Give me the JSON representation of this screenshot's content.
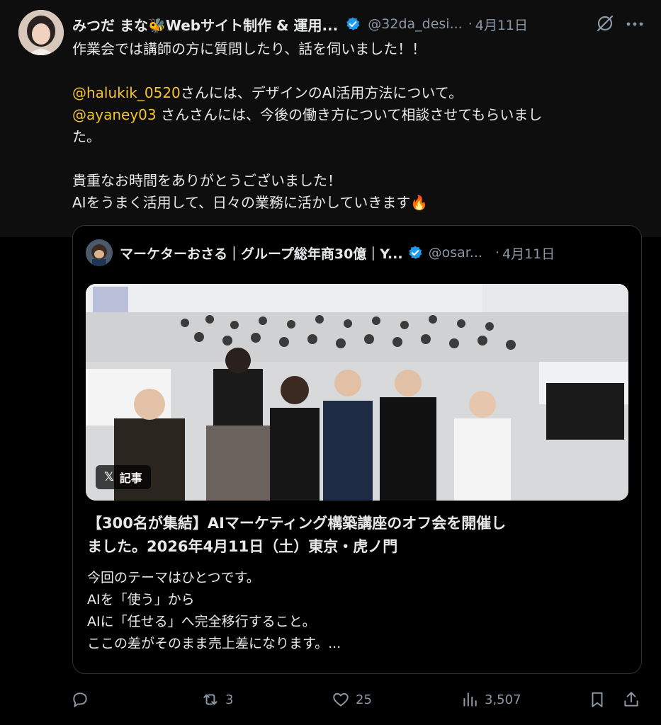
{
  "author": {
    "display_name": "みつだ まな🐝Webサイト制作 & 運用...",
    "handle": "@32da_desi...",
    "date": "4月11日"
  },
  "tweet": {
    "lines": [
      "作業会では講師の方に質問したり、話を伺いました！！",
      "",
      "さんには、デザインのAI活用方法について。",
      " さんさんには、今後の働き方について相談させてもらいまし",
      "た。",
      "",
      "貴重なお時間をありがとうございました！",
      "AIをうまく活用して、日々の業務に活かしていきます🔥"
    ],
    "mentions": [
      "@halukik_0520",
      "@ayaney03"
    ]
  },
  "quote": {
    "display_name": "マーケターおさる｜グループ総年商30億｜Y...",
    "handle": "@osar...",
    "date": "4月11日",
    "badge_label": "記事",
    "badge_x": "𝕏",
    "title_lines": [
      "【300名が集結】AIマーケティング構築講座のオフ会を開催し",
      "ました。2026年4月11日（土）東京・虎ノ門"
    ],
    "body_lines": [
      "今回のテーマはひとつです。",
      "AIを「使う」から",
      "AIに「任せる」へ完全移行すること。",
      "ここの差がそのまま売上差になります。..."
    ]
  },
  "actions": {
    "reply_count": "",
    "retweet_count": "3",
    "like_count": "25",
    "view_count": "3,507"
  },
  "colors": {
    "background": "#000000",
    "text": "#e7e9ea",
    "secondary": "#8b98a5",
    "mention": "#f4c430",
    "verified": "#1d9bf0",
    "border": "#2f3336"
  },
  "icons": [
    "verified-icon",
    "grok-icon",
    "more-icon",
    "reply-icon",
    "retweet-icon",
    "like-icon",
    "views-icon",
    "bookmark-icon",
    "share-icon",
    "x-logo-icon"
  ]
}
